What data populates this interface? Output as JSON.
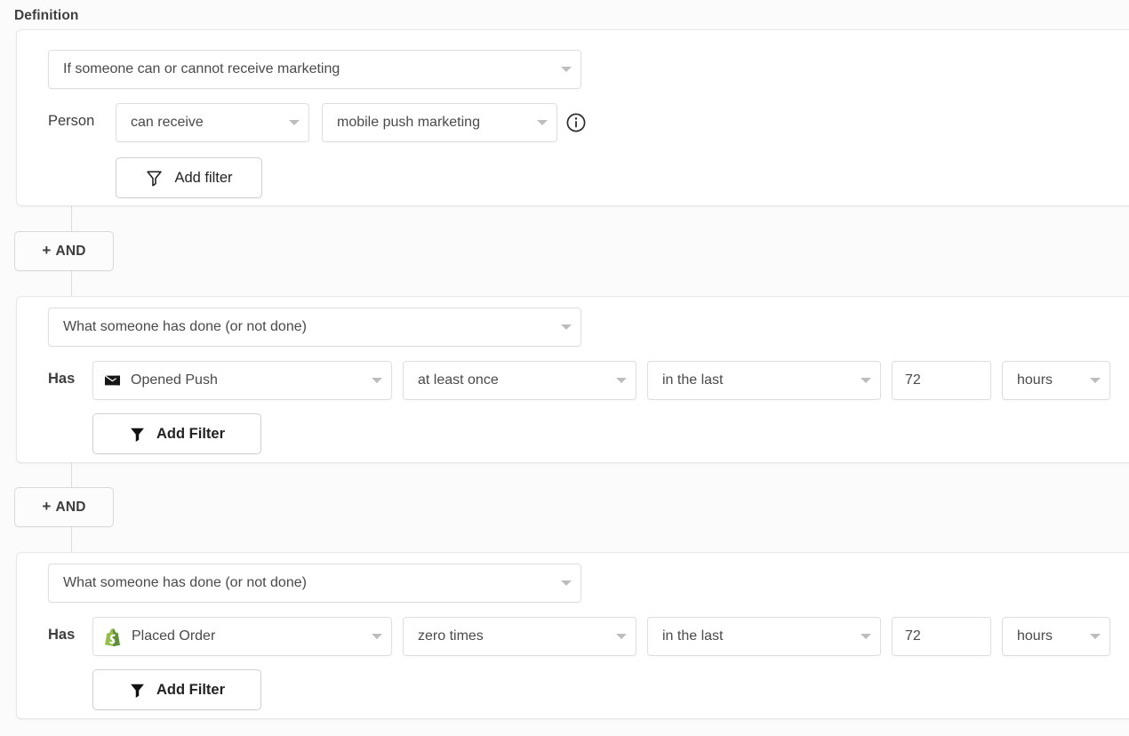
{
  "section": {
    "title": "Definition"
  },
  "colors": {
    "page_background": "#fbfbfb",
    "card_background": "#ffffff",
    "border": "#e0e0e0",
    "text": "#3d3d3d",
    "shopify_green": "#95bf47",
    "shopify_green_dark": "#5e8e3e",
    "push_icon": "#1a1a1a"
  },
  "connector": {
    "label": "AND",
    "plus": "+"
  },
  "blocks": [
    {
      "type_select": {
        "value": "If someone can or cannot receive marketing",
        "icon": "chevron-down-icon"
      },
      "row": {
        "prefix": "Person",
        "bold_prefix": false,
        "fields": [
          {
            "name": "consent-state-select",
            "value": "can receive",
            "icon": "chevron-down-icon"
          },
          {
            "name": "marketing-channel-select",
            "value": "mobile push marketing",
            "icon": "chevron-down-icon"
          }
        ],
        "info_icon": "info-circle-icon"
      },
      "add_filter": {
        "label": "Add filter",
        "icon": "funnel-outline-icon",
        "bold": false
      }
    },
    {
      "type_select": {
        "value": "What someone has done (or not done)",
        "icon": "chevron-down-icon"
      },
      "row": {
        "prefix": "Has",
        "bold_prefix": true,
        "fields": [
          {
            "name": "metric-select",
            "value": "Opened Push",
            "icon": "push-notification-icon"
          },
          {
            "name": "frequency-select",
            "value": "at least once",
            "icon": "chevron-down-icon"
          },
          {
            "name": "timeframe-select",
            "value": "in the last",
            "icon": "chevron-down-icon"
          },
          {
            "name": "duration-value-input",
            "value": "72",
            "icon": ""
          },
          {
            "name": "duration-unit-select",
            "value": "hours",
            "icon": "chevron-down-icon"
          }
        ]
      },
      "add_filter": {
        "label": "Add Filter",
        "icon": "funnel-solid-icon",
        "bold": true
      }
    },
    {
      "type_select": {
        "value": "What someone has done (or not done)",
        "icon": "chevron-down-icon"
      },
      "row": {
        "prefix": "Has",
        "bold_prefix": true,
        "fields": [
          {
            "name": "metric-select",
            "value": "Placed Order",
            "icon": "shopify-icon"
          },
          {
            "name": "frequency-select",
            "value": "zero times",
            "icon": "chevron-down-icon"
          },
          {
            "name": "timeframe-select",
            "value": "in the last",
            "icon": "chevron-down-icon"
          },
          {
            "name": "duration-value-input",
            "value": "72",
            "icon": ""
          },
          {
            "name": "duration-unit-select",
            "value": "hours",
            "icon": "chevron-down-icon"
          }
        ]
      },
      "add_filter": {
        "label": "Add Filter",
        "icon": "funnel-solid-icon",
        "bold": true
      }
    }
  ]
}
